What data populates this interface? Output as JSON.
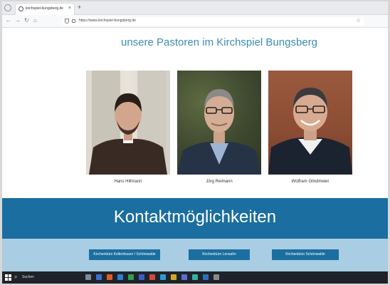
{
  "browser": {
    "tab_title": "kirchspiel-bungsberg.de",
    "url": "https://www.kirchspiel-bungsberg.de"
  },
  "page": {
    "heading": "unsere Pastoren im Kirchspiel Bungsberg",
    "pastors": [
      {
        "name": "Hans Hillmann"
      },
      {
        "name": "Jörg Reimann"
      },
      {
        "name": "Wolfram Glindmeier"
      }
    ],
    "contact_heading": "Kontaktmöglichkeiten",
    "contact_buttons": [
      {
        "label": "Kirchenbüro Kellenhusen / Schönwalde"
      },
      {
        "label": "Kirchenbüro Lensahn"
      },
      {
        "label": "Kirchenbüro Schönwalde"
      }
    ]
  },
  "taskbar": {
    "search_label": "Suchen"
  },
  "colors": {
    "heading_text": "#3c8cb4",
    "contact_band": "#1b6ea0",
    "button_band": "#a9cde3"
  }
}
